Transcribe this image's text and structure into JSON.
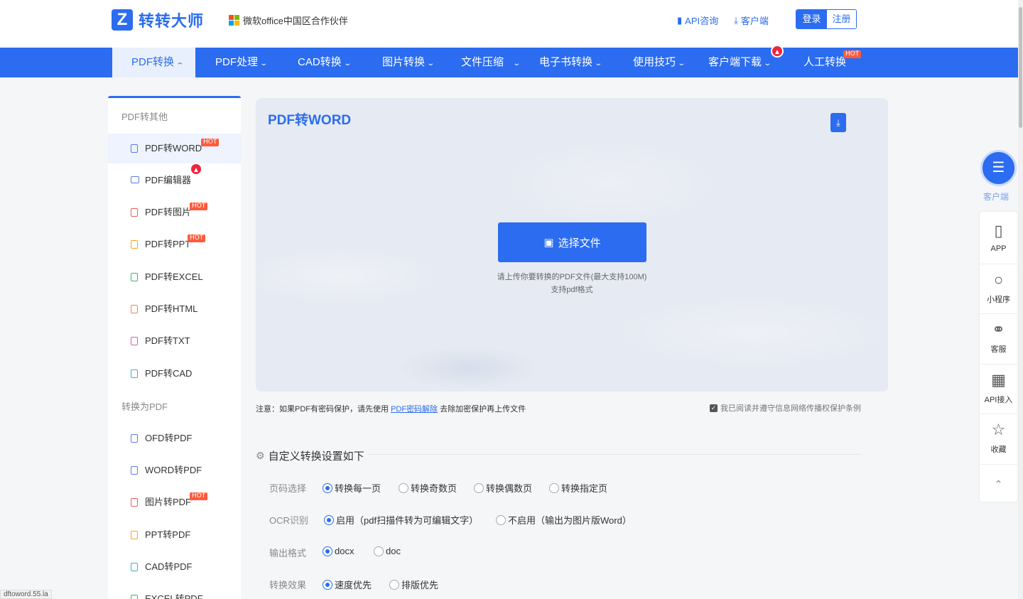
{
  "header": {
    "logo_mark": "Z",
    "logo_text": "转转大师",
    "partner_text": "微软office中国区合作伙伴",
    "api_label": "API咨询",
    "client_label": "客户端",
    "login_label": "登录",
    "register_label": "注册",
    "colors": {
      "brand": "#2b6cf0",
      "ms_red": "#f25022",
      "ms_green": "#7fba00",
      "ms_blue": "#00a4ef",
      "ms_yellow": "#ffb900"
    }
  },
  "nav": {
    "items": [
      {
        "label": "PDF转换"
      },
      {
        "label": "PDF处理"
      },
      {
        "label": "CAD转换"
      },
      {
        "label": "图片转换"
      },
      {
        "label": "文件压缩"
      },
      {
        "label": "电子书转换"
      },
      {
        "label": "使用技巧"
      },
      {
        "label": "客户端下载"
      },
      {
        "label": "人工转换"
      }
    ],
    "hot_text": "HOT"
  },
  "sidebar": {
    "group_1": "PDF转其他",
    "items_1": [
      {
        "label": "PDF转WORD"
      },
      {
        "label": "PDF编辑器"
      },
      {
        "label": "PDF转图片"
      },
      {
        "label": "PDF转PPT"
      },
      {
        "label": "PDF转EXCEL"
      },
      {
        "label": "PDF转HTML"
      },
      {
        "label": "PDF转TXT"
      },
      {
        "label": "PDF转CAD"
      }
    ],
    "group_2": "转换为PDF",
    "items_2": [
      {
        "label": "OFD转PDF"
      },
      {
        "label": "WORD转PDF"
      },
      {
        "label": "图片转PDF"
      },
      {
        "label": "PPT转PDF"
      },
      {
        "label": "CAD转PDF"
      },
      {
        "label": "EXCEL转PDF"
      }
    ],
    "hot_text": "HOT"
  },
  "upload": {
    "title": "PDF转WORD",
    "choose_label": "选择文件",
    "hint_1": "请上传你要转换的PDF文件(最大支持100M)",
    "hint_2": "支持pdf格式"
  },
  "notice": {
    "prefix": "注意：如果PDF有密码保护，请先使用",
    "link": "PDF密码解除",
    "suffix": "去除加密保护再上传文件",
    "agree": "我已阅读并遵守信息网络传播权保护条例"
  },
  "settings": {
    "title": "自定义转换设置如下",
    "rows": [
      {
        "label": "页码选择",
        "options": [
          "转换每一页",
          "转换奇数页",
          "转换偶数页",
          "转换指定页"
        ],
        "selected": "转换每一页"
      },
      {
        "label": "OCR识别",
        "options": [
          "启用（pdf扫描件转为可编辑文字）",
          "不启用（输出为图片版Word）"
        ],
        "selected": "启用（pdf扫描件转为可编辑文字）"
      },
      {
        "label": "输出格式",
        "options": [
          "docx",
          "doc"
        ],
        "selected": "docx"
      },
      {
        "label": "转换效果",
        "options": [
          "速度优先",
          "排版优先"
        ],
        "selected": "速度优先"
      }
    ]
  },
  "right_float": {
    "client": "客户端",
    "items": [
      {
        "label": "APP"
      },
      {
        "label": "小程序"
      },
      {
        "label": "客服"
      },
      {
        "label": "API接入"
      },
      {
        "label": "收藏"
      }
    ]
  },
  "status_url": "dftoword.55.la"
}
